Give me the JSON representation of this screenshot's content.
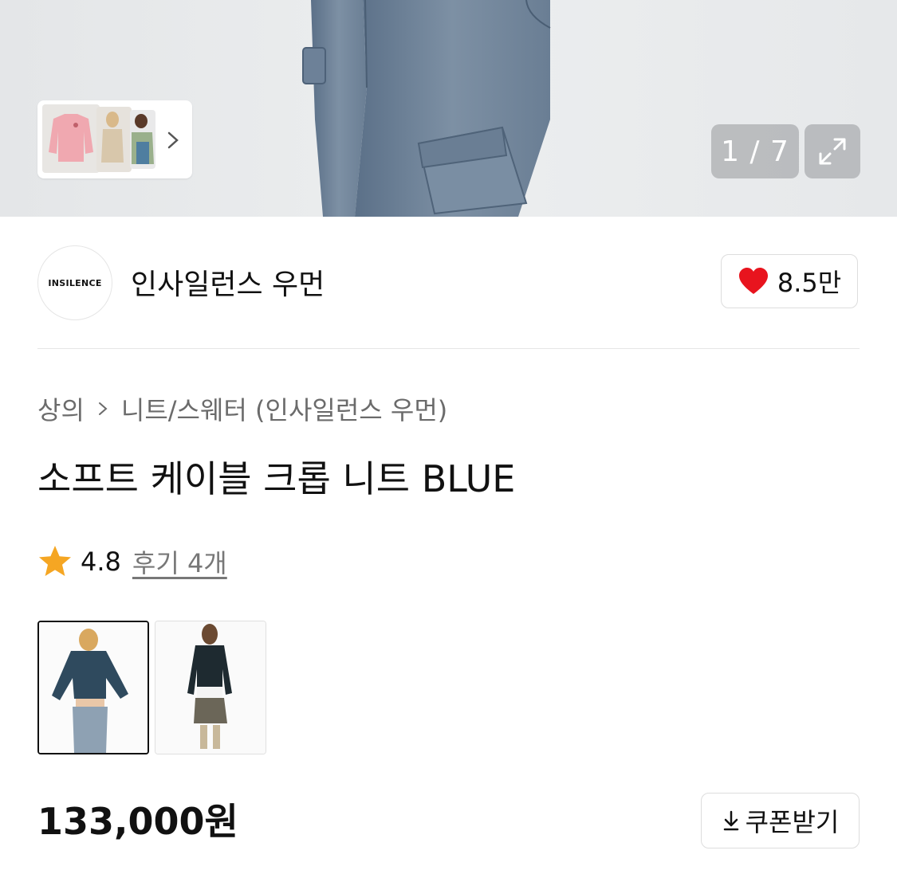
{
  "gallery": {
    "counter": "1 / 7",
    "thumbnails": [
      "pink-sweater",
      "beige-knit",
      "green-knit"
    ]
  },
  "brand": {
    "logo_text": "INSILENCE",
    "name": "인사일런스 우먼",
    "likes": "8.5만"
  },
  "breadcrumb": {
    "category": "상의",
    "subcategory": "니트/스웨터 (인사일런스 우먼)"
  },
  "product": {
    "title": "소프트 케이블 크롭 니트 BLUE",
    "rating": "4.8",
    "reviews": "후기 4개",
    "price": "133,000원"
  },
  "coupon": {
    "label": "쿠폰받기"
  },
  "colors": {
    "heart": "#e8141e",
    "star": "#f5a623"
  }
}
